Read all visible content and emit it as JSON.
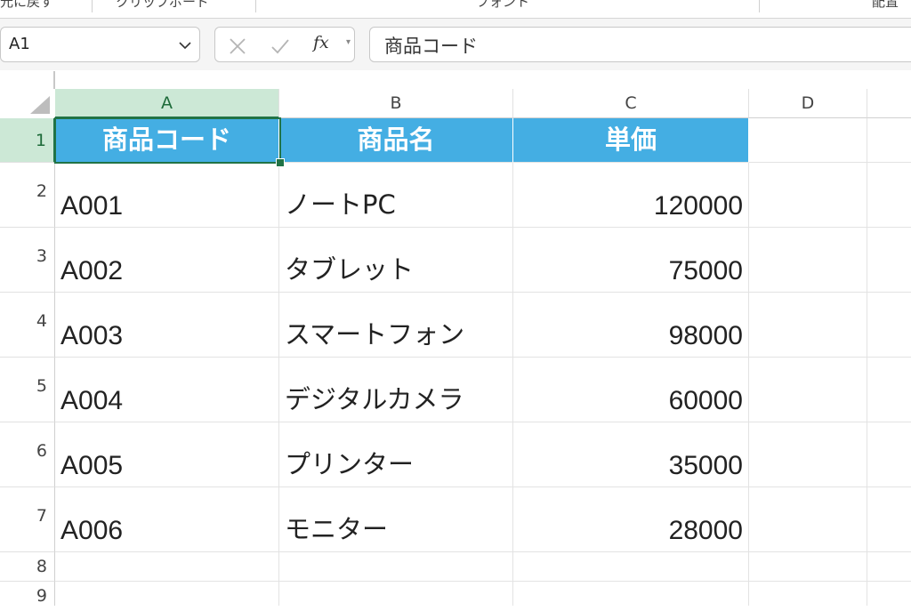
{
  "ribbon": {
    "groups": [
      "元に戻す",
      "クリップボード",
      "フォント",
      "配置"
    ]
  },
  "formula_bar": {
    "name_box": "A1",
    "fx_label": "fx",
    "formula_value": "商品コード"
  },
  "columns": [
    "A",
    "B",
    "C",
    "D"
  ],
  "rows": [
    "1",
    "2",
    "3",
    "4",
    "5",
    "6",
    "7",
    "8",
    "9"
  ],
  "sheet": {
    "header": [
      "商品コード",
      "商品名",
      "単価"
    ],
    "data": [
      {
        "code": "A001",
        "name": "ノートPC",
        "price": "120000"
      },
      {
        "code": "A002",
        "name": "タブレット",
        "price": "75000"
      },
      {
        "code": "A003",
        "name": "スマートフォン",
        "price": "98000"
      },
      {
        "code": "A004",
        "name": "デジタルカメラ",
        "price": "60000"
      },
      {
        "code": "A005",
        "name": "プリンター",
        "price": "35000"
      },
      {
        "code": "A006",
        "name": "モニター",
        "price": "28000"
      }
    ]
  },
  "colors": {
    "header_fill": "#44aee3",
    "selection": "#217346",
    "selected_header": "#cce8d6"
  },
  "icons": [
    "chevron-down-icon",
    "cancel-icon",
    "enter-icon",
    "fx-icon",
    "select-all-icon"
  ]
}
